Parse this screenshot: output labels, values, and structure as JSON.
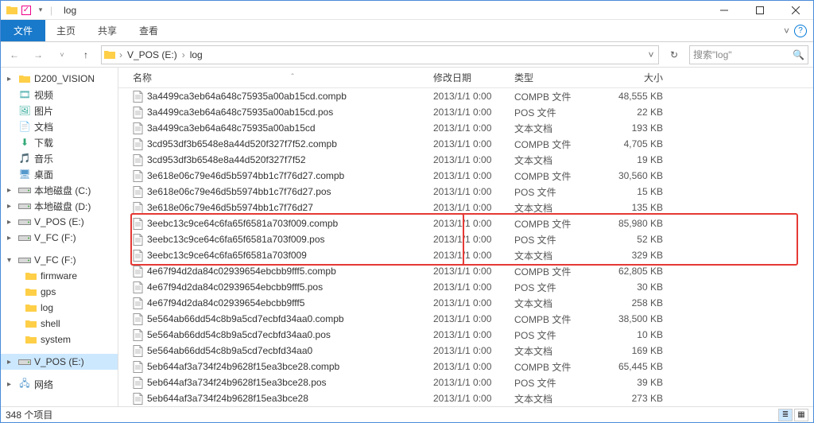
{
  "titlebar": {
    "title": "log"
  },
  "ribbon": {
    "file": "文件",
    "tabs": [
      "主页",
      "共享",
      "查看"
    ]
  },
  "address": {
    "crumbs": [
      "V_POS (E:)",
      "log"
    ],
    "refresh_tip": "刷新",
    "search_placeholder": "搜索\"log\""
  },
  "sidebar": {
    "items": [
      {
        "label": "D200_VISION",
        "icon": "folder",
        "expander": "▸",
        "kind": "item"
      },
      {
        "label": "视频",
        "icon": "video",
        "expander": "",
        "kind": "item"
      },
      {
        "label": "图片",
        "icon": "pictures",
        "expander": "",
        "kind": "item"
      },
      {
        "label": "文档",
        "icon": "documents",
        "expander": "",
        "kind": "item"
      },
      {
        "label": "下载",
        "icon": "downloads",
        "expander": "",
        "kind": "item"
      },
      {
        "label": "音乐",
        "icon": "music",
        "expander": "",
        "kind": "item"
      },
      {
        "label": "桌面",
        "icon": "desktop",
        "expander": "",
        "kind": "item"
      },
      {
        "label": "本地磁盘 (C:)",
        "icon": "drive",
        "expander": "▸",
        "kind": "item"
      },
      {
        "label": "本地磁盘 (D:)",
        "icon": "drive",
        "expander": "▸",
        "kind": "item"
      },
      {
        "label": "V_POS (E:)",
        "icon": "drive",
        "expander": "▸",
        "kind": "item"
      },
      {
        "label": "V_FC (F:)",
        "icon": "drive",
        "expander": "▸",
        "kind": "item"
      },
      {
        "kind": "spacer"
      },
      {
        "label": "V_FC (F:)",
        "icon": "drive",
        "expander": "▾",
        "kind": "item"
      },
      {
        "label": "firmware",
        "icon": "folder",
        "kind": "child"
      },
      {
        "label": "gps",
        "icon": "folder",
        "kind": "child"
      },
      {
        "label": "log",
        "icon": "folder",
        "kind": "child"
      },
      {
        "label": "shell",
        "icon": "folder",
        "kind": "child"
      },
      {
        "label": "system",
        "icon": "folder",
        "kind": "child"
      },
      {
        "kind": "spacer"
      },
      {
        "label": "V_POS (E:)",
        "icon": "drive",
        "expander": "▸",
        "kind": "item",
        "selected": true
      },
      {
        "kind": "spacer"
      },
      {
        "label": "网络",
        "icon": "network",
        "expander": "▸",
        "kind": "item"
      }
    ]
  },
  "columns": {
    "name": "名称",
    "date": "修改日期",
    "type": "类型",
    "size": "大小"
  },
  "files": [
    {
      "name": "3a4499ca3eb64a648c75935a00ab15cd.compb",
      "date": "2013/1/1 0:00",
      "type": "COMPB 文件",
      "size": "48,555 KB"
    },
    {
      "name": "3a4499ca3eb64a648c75935a00ab15cd.pos",
      "date": "2013/1/1 0:00",
      "type": "POS 文件",
      "size": "22 KB"
    },
    {
      "name": "3a4499ca3eb64a648c75935a00ab15cd",
      "date": "2013/1/1 0:00",
      "type": "文本文档",
      "size": "193 KB"
    },
    {
      "name": "3cd953df3b6548e8a44d520f327f7f52.compb",
      "date": "2013/1/1 0:00",
      "type": "COMPB 文件",
      "size": "4,705 KB"
    },
    {
      "name": "3cd953df3b6548e8a44d520f327f7f52",
      "date": "2013/1/1 0:00",
      "type": "文本文档",
      "size": "19 KB"
    },
    {
      "name": "3e618e06c79e46d5b5974bb1c7f76d27.compb",
      "date": "2013/1/1 0:00",
      "type": "COMPB 文件",
      "size": "30,560 KB"
    },
    {
      "name": "3e618e06c79e46d5b5974bb1c7f76d27.pos",
      "date": "2013/1/1 0:00",
      "type": "POS 文件",
      "size": "15 KB"
    },
    {
      "name": "3e618e06c79e46d5b5974bb1c7f76d27",
      "date": "2013/1/1 0:00",
      "type": "文本文档",
      "size": "135 KB"
    },
    {
      "name": "3eebc13c9ce64c6fa65f6581a703f009.compb",
      "date": "2013/1/1 0:00",
      "type": "COMPB 文件",
      "size": "85,980 KB",
      "hl": true
    },
    {
      "name": "3eebc13c9ce64c6fa65f6581a703f009.pos",
      "date": "2013/1/1 0:00",
      "type": "POS 文件",
      "size": "52 KB",
      "hl": true
    },
    {
      "name": "3eebc13c9ce64c6fa65f6581a703f009",
      "date": "2013/1/1 0:00",
      "type": "文本文档",
      "size": "329 KB",
      "hl": true
    },
    {
      "name": "4e67f94d2da84c02939654ebcbb9fff5.compb",
      "date": "2013/1/1 0:00",
      "type": "COMPB 文件",
      "size": "62,805 KB"
    },
    {
      "name": "4e67f94d2da84c02939654ebcbb9fff5.pos",
      "date": "2013/1/1 0:00",
      "type": "POS 文件",
      "size": "30 KB"
    },
    {
      "name": "4e67f94d2da84c02939654ebcbb9fff5",
      "date": "2013/1/1 0:00",
      "type": "文本文档",
      "size": "258 KB"
    },
    {
      "name": "5e564ab66dd54c8b9a5cd7ecbfd34aa0.compb",
      "date": "2013/1/1 0:00",
      "type": "COMPB 文件",
      "size": "38,500 KB"
    },
    {
      "name": "5e564ab66dd54c8b9a5cd7ecbfd34aa0.pos",
      "date": "2013/1/1 0:00",
      "type": "POS 文件",
      "size": "10 KB"
    },
    {
      "name": "5e564ab66dd54c8b9a5cd7ecbfd34aa0",
      "date": "2013/1/1 0:00",
      "type": "文本文档",
      "size": "169 KB"
    },
    {
      "name": "5eb644af3a734f24b9628f15ea3bce28.compb",
      "date": "2013/1/1 0:00",
      "type": "COMPB 文件",
      "size": "65,445 KB"
    },
    {
      "name": "5eb644af3a734f24b9628f15ea3bce28.pos",
      "date": "2013/1/1 0:00",
      "type": "POS 文件",
      "size": "39 KB"
    },
    {
      "name": "5eb644af3a734f24b9628f15ea3bce28",
      "date": "2013/1/1 0:00",
      "type": "文本文档",
      "size": "273 KB"
    }
  ],
  "status": {
    "count": "348 个项目"
  },
  "highlight": {
    "name_box": true,
    "row_box": true
  }
}
